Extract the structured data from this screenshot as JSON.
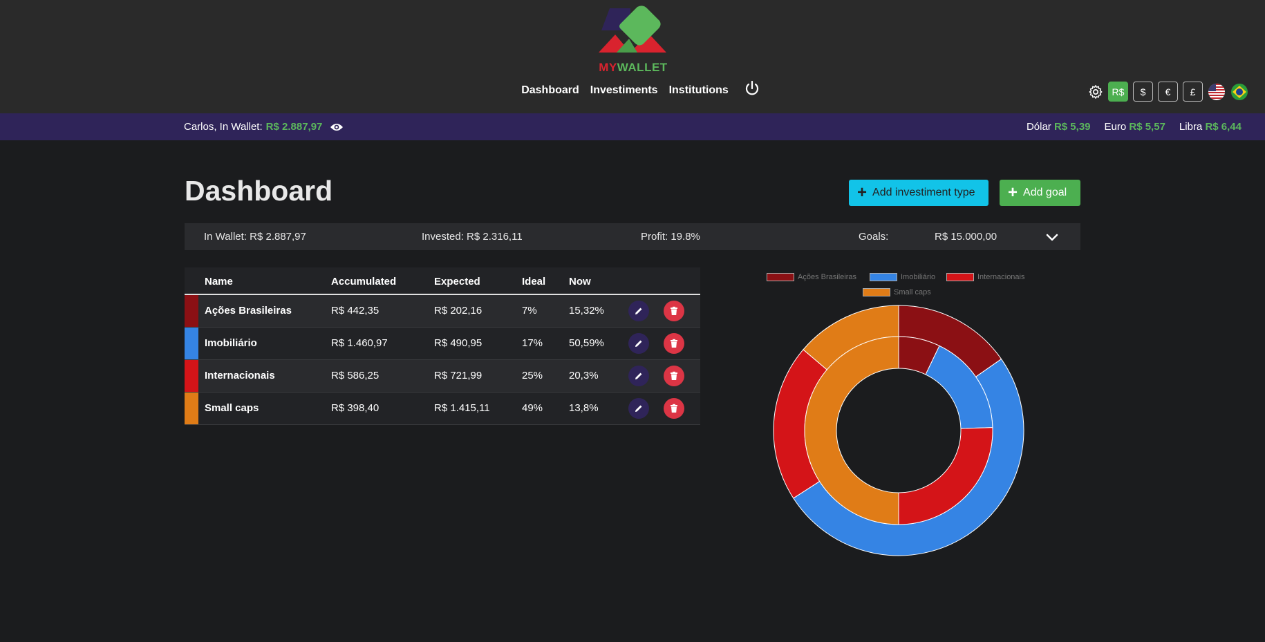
{
  "header": {
    "logo": {
      "my": "MY",
      "wallet": "WALLET"
    },
    "nav": [
      "Dashboard",
      "Investiments",
      "Institutions"
    ],
    "currencies": [
      {
        "label": "R$",
        "active": true
      },
      {
        "label": "$",
        "active": false
      },
      {
        "label": "€",
        "active": false
      },
      {
        "label": "£",
        "active": false
      }
    ]
  },
  "status": {
    "greeting": "Carlos, In Wallet:",
    "wallet_value": "R$ 2.887,97",
    "rates": [
      {
        "label": "Dólar",
        "value": "R$ 5,39"
      },
      {
        "label": "Euro",
        "value": "R$ 5,57"
      },
      {
        "label": "Libra",
        "value": "R$ 6,44"
      }
    ]
  },
  "page": {
    "title": "Dashboard",
    "add_investment_label": "Add investiment type",
    "add_goal_label": "Add goal"
  },
  "summary": {
    "in_wallet": "In Wallet: R$ 2.887,97",
    "invested": "Invested: R$ 2.316,11",
    "profit": "Profit: 19.8%",
    "goals_label": "Goals:",
    "goals_value": "R$ 15.000,00"
  },
  "table": {
    "headers": [
      "Name",
      "Accumulated",
      "Expected",
      "Ideal",
      "Now"
    ],
    "rows": [
      {
        "name": "Ações Brasileiras",
        "accumulated": "R$ 442,35",
        "expected": "R$ 202,16",
        "ideal": "7%",
        "now": "15,32%",
        "color": "#8b1014"
      },
      {
        "name": "Imobiliário",
        "accumulated": "R$ 1.460,97",
        "expected": "R$ 490,95",
        "ideal": "17%",
        "now": "50,59%",
        "color": "#3584e4"
      },
      {
        "name": "Internacionais",
        "accumulated": "R$ 586,25",
        "expected": "R$ 721,99",
        "ideal": "25%",
        "now": "20,3%",
        "color": "#d41418"
      },
      {
        "name": "Small caps",
        "accumulated": "R$ 398,40",
        "expected": "R$ 1.415,11",
        "ideal": "49%",
        "now": "13,8%",
        "color": "#e07c17"
      }
    ]
  },
  "chart_data": {
    "type": "pie",
    "categories": [
      "Ações Brasileiras",
      "Imobiliário",
      "Internacionais",
      "Small caps"
    ],
    "colors": [
      "#8b1014",
      "#3584e4",
      "#d41418",
      "#e07c17"
    ],
    "series": [
      {
        "values": [
          15.32,
          50.59,
          20.3,
          13.8
        ]
      },
      {
        "values": [
          7,
          17,
          25,
          49
        ]
      }
    ],
    "legend_position": "top"
  }
}
